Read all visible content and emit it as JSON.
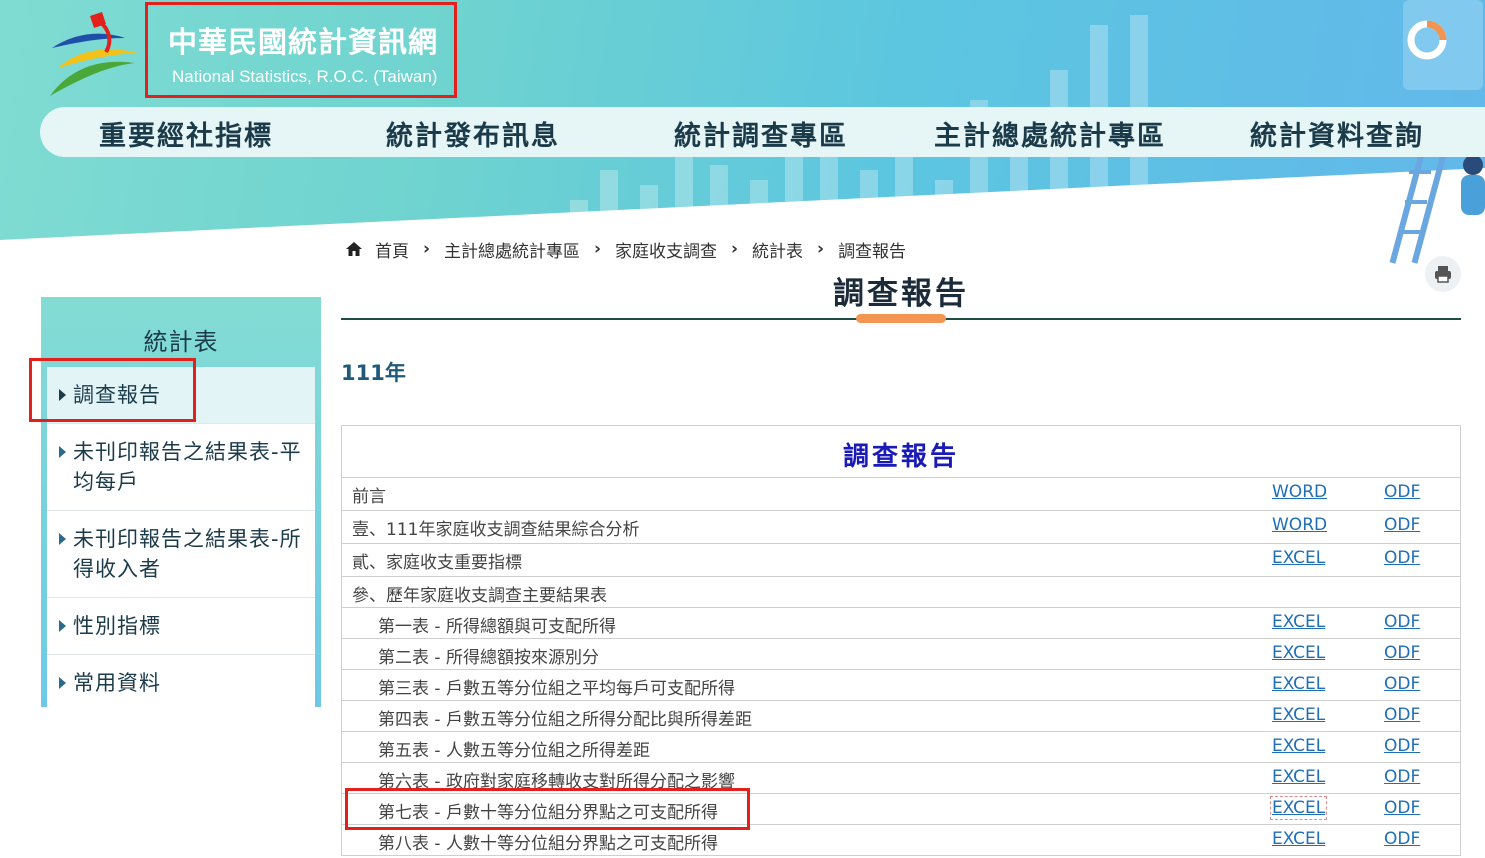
{
  "header": {
    "title": "中華民國統計資訊網",
    "subtitle": "National Statistics, R.O.C. (Taiwan)",
    "nav": [
      "重要經社指標",
      "統計發布訊息",
      "統計調查專區",
      "主計總處統計專區",
      "統計資料查詢"
    ]
  },
  "breadcrumb": [
    "首頁",
    "主計總處統計專區",
    "家庭收支調查",
    "統計表",
    "調查報告"
  ],
  "page": {
    "title": "調查報告",
    "year": "111年"
  },
  "sidebar": {
    "title": "統計表",
    "items": [
      {
        "label": "調查報告"
      },
      {
        "label": "未刊印報告之結果表-平均每戶"
      },
      {
        "label": "未刊印報告之結果表-所得收入者"
      },
      {
        "label": "性別指標"
      },
      {
        "label": "常用資料"
      }
    ]
  },
  "table": {
    "heading": "調查報告",
    "rows": [
      {
        "label": "前言",
        "link1": "WORD",
        "link2": "ODF"
      },
      {
        "label": "壹、111年家庭收支調查結果綜合分析",
        "link1": "WORD",
        "link2": "ODF"
      },
      {
        "label": "貳、家庭收支重要指標",
        "link1": "EXCEL",
        "link2": "ODF"
      },
      {
        "label": "參、歷年家庭收支調查主要結果表",
        "link1": "",
        "link2": ""
      },
      {
        "label": "第一表 - 所得總額與可支配所得",
        "link1": "EXCEL",
        "link2": "ODF"
      },
      {
        "label": "第二表 - 所得總額按來源別分",
        "link1": "EXCEL",
        "link2": "ODF"
      },
      {
        "label": "第三表 - 戶數五等分位組之平均每戶可支配所得",
        "link1": "EXCEL",
        "link2": "ODF"
      },
      {
        "label": "第四表 - 戶數五等分位組之所得分配比與所得差距",
        "link1": "EXCEL",
        "link2": "ODF"
      },
      {
        "label": "第五表 - 人數五等分位組之所得差距",
        "link1": "EXCEL",
        "link2": "ODF"
      },
      {
        "label": "第六表 - 政府對家庭移轉收支對所得分配之影響",
        "link1": "EXCEL",
        "link2": "ODF"
      },
      {
        "label": "第七表 - 戶數十等分位組分界點之可支配所得",
        "link1": "EXCEL",
        "link2": "ODF"
      },
      {
        "label": "第八表 - 人數十等分位組分界點之可支配所得",
        "link1": "EXCEL",
        "link2": "ODF"
      }
    ]
  },
  "icons": [
    "home-icon",
    "print-icon",
    "logo-icon",
    "caret-right-icon"
  ],
  "colors": {
    "highlight": "#e2211c",
    "link": "#1f6fb8",
    "heading": "#1a1ab8",
    "accent": "#f29552"
  }
}
